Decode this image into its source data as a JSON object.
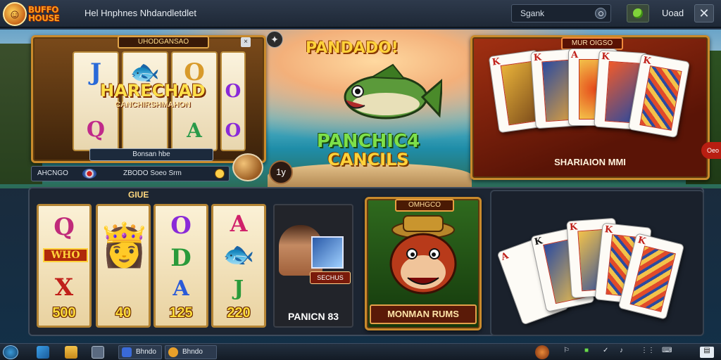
{
  "app": {
    "logo_line1": "BUFFO",
    "logo_line2": "HOUSE",
    "title": "Hel Hnphnes Nhdandletdlet"
  },
  "header": {
    "search_value": "Sgank",
    "user_name": "Uoad",
    "close_glyph": "✕"
  },
  "slot_panel": {
    "label": "UHODGANSAO",
    "close_glyph": "×",
    "reels": [
      [
        "J",
        "Q"
      ],
      [
        "🐟",
        ""
      ],
      [
        "O",
        "A"
      ],
      [
        "O",
        "O"
      ]
    ],
    "banner_title": "HARECHAD",
    "banner_sub": "CANCHIRSHMAHON",
    "info_bar": "Bonsan hbe",
    "footer_left": "AHCNGO",
    "footer_mid": "ZBODO Soeo Srm",
    "star_glyph": "✦",
    "round_btn": "1y"
  },
  "hero": {
    "title": "PANDADO!",
    "sub1": "PANCHIC4",
    "sub2": "CANCILS"
  },
  "poker_top": {
    "label": "MUR OIGSO",
    "caption": "SHARIAION MMI",
    "side_tab": "Oeo",
    "cards": [
      "K",
      "K",
      "A",
      "K",
      "K"
    ]
  },
  "bottom": {
    "label": "GIUE",
    "reels": [
      {
        "symbols": [
          "Q",
          "WHO",
          "X"
        ],
        "value": "500"
      },
      {
        "symbols": [
          "👸",
          "",
          ""
        ],
        "value": "40"
      },
      {
        "symbols": [
          "O",
          "D",
          "A"
        ],
        "value": "125"
      },
      {
        "symbols": [
          "A",
          "🐟",
          "J"
        ],
        "value": "220"
      }
    ],
    "dealer_tag": "SECHUS",
    "dealer_caption": "PANICN 83",
    "hero_label": "OMHGCO",
    "hero_caption": "MONMAN RUMS",
    "cards": [
      "A",
      "K",
      "K",
      "K",
      "K"
    ]
  },
  "taskbar": {
    "task1": "Bhndo",
    "task2": "Bhndo"
  },
  "colors": {
    "gold": "#c98a2c",
    "accent_green": "#7fd33a",
    "card_red": "#c0201a"
  }
}
